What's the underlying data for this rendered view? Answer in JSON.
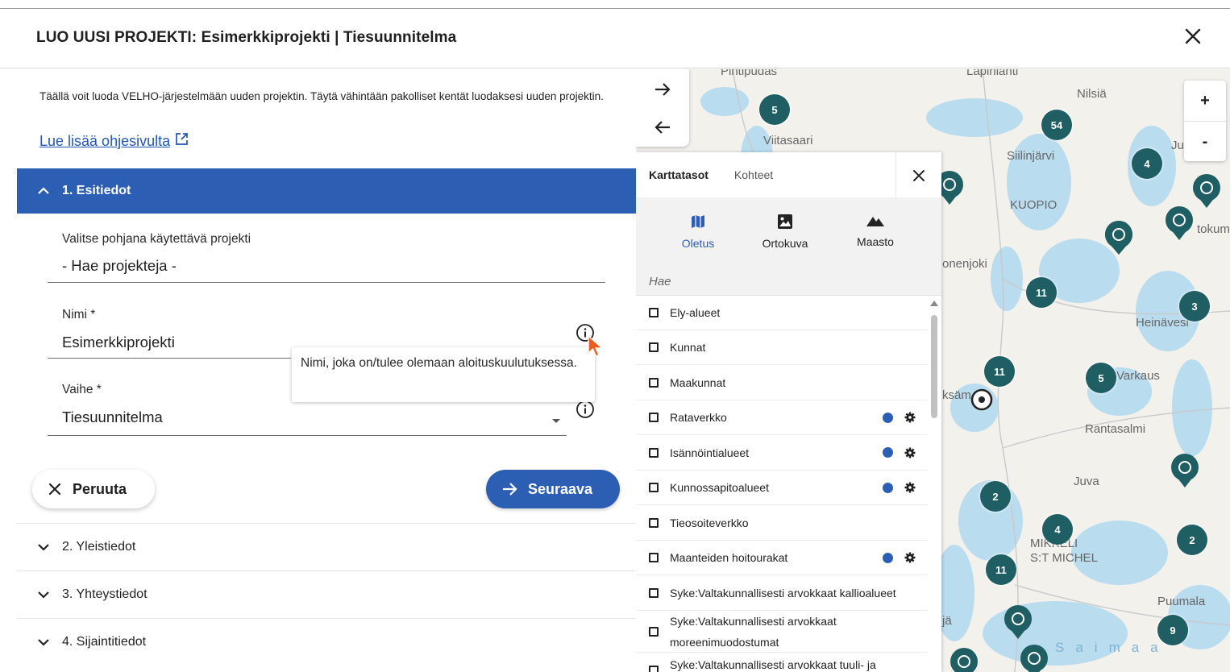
{
  "dialog": {
    "title": "LUO UUSI PROJEKTI: Esimerkkiprojekti | Tiesuunnitelma",
    "close_icon": "close-icon"
  },
  "intro": {
    "text": "Täällä voit luoda VELHO-järjestelmään uuden projektin. Täytä vähintään pakolliset kentät luodaksesi uuden projektin.",
    "help_link": "Lue lisää ohjesivulta"
  },
  "sections": {
    "s1": "1. Esitiedot",
    "s2": "2. Yleistiedot",
    "s3": "3. Yhteystiedot",
    "s4": "4. Sijaintitiedot"
  },
  "form": {
    "base_project": {
      "label": "Valitse pohjana käytettävä projekti",
      "value": "- Hae projekteja -"
    },
    "name": {
      "label": "Nimi *",
      "value": "Esimerkkiprojekti"
    },
    "phase": {
      "label": "Vaihe *",
      "value": "Tiesuunnitelma"
    },
    "tooltip": "Nimi, joka on/tulee olemaan aloituskuulutuksessa."
  },
  "buttons": {
    "cancel": "Peruuta",
    "next": "Seuraava"
  },
  "map": {
    "accent": "#2c5eb4",
    "cluster_color": "#1f5e63",
    "tabs": {
      "layers": "Karttatasot",
      "objects": "Kohteet"
    },
    "basemaps": [
      {
        "label": "Oletus",
        "icon": "map-icon",
        "selected": true
      },
      {
        "label": "Ortokuva",
        "icon": "image-icon",
        "selected": false
      },
      {
        "label": "Maasto",
        "icon": "mountain-icon",
        "selected": false
      }
    ],
    "search_placeholder": "Hae",
    "layers": [
      {
        "label": "Ely-alueet",
        "dot": false
      },
      {
        "label": "Kunnat",
        "dot": false
      },
      {
        "label": "Maakunnat",
        "dot": false
      },
      {
        "label": "Rataverkko",
        "dot": true
      },
      {
        "label": "Isännöintialueet",
        "dot": true
      },
      {
        "label": "Kunnossapitoalueet",
        "dot": true
      },
      {
        "label": "Tieosoiteverkko",
        "dot": false
      },
      {
        "label": "Maanteiden hoitourakat",
        "dot": true
      },
      {
        "label": "Syke:Valtakunnallisesti arvokkaat kallioalueet",
        "dot": false
      },
      {
        "label": "Syke:Valtakunnallisesti arvokkaat moreenimuodostumat",
        "dot": false
      },
      {
        "label": "Syke:Valtakunnallisesti arvokkaat tuuli- ja",
        "dot": false
      }
    ],
    "place_labels": [
      "Pihtipudas",
      "Lapinlahti",
      "Nilsiä",
      "Viitasaari",
      "Siilinjärvi",
      "Ju",
      "KUOPIO",
      "tokum",
      "onenjoki",
      "Heinävesi",
      "Varkaus",
      "ksäm",
      "Rantasalmi",
      "Juva",
      "MIKKELI",
      "S:T MICHEL",
      "Puumala",
      "jä",
      "Saimaa"
    ],
    "clusters": [
      "5",
      "54",
      "4",
      "11",
      "3",
      "11",
      "5",
      "2",
      "4",
      "2",
      "11",
      "9"
    ],
    "zoom_in": "+",
    "zoom_out": "-"
  }
}
